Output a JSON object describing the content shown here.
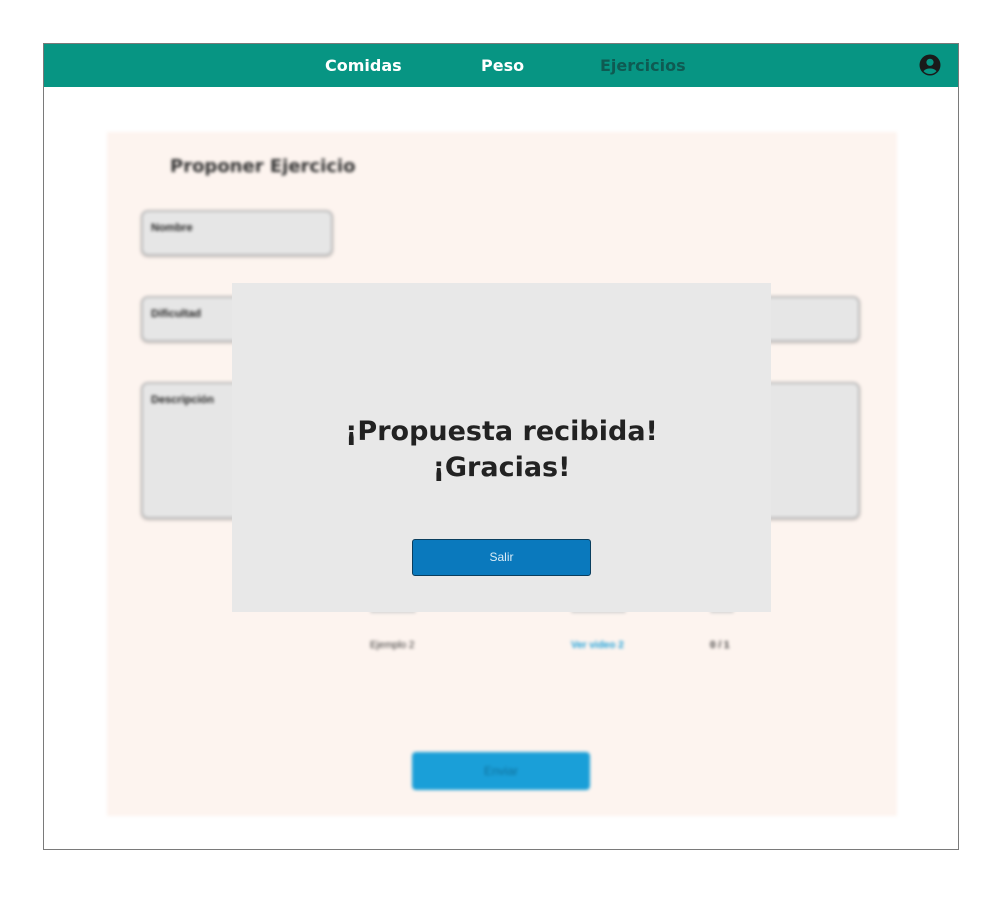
{
  "nav": {
    "items": [
      {
        "label": "Comidas"
      },
      {
        "label": "Peso"
      },
      {
        "label": "Ejercicios"
      }
    ],
    "profile_icon": "user-circle-icon"
  },
  "form": {
    "title": "Proponer Ejercicio",
    "fields": {
      "nombre_placeholder": "Nombre",
      "dificultad_placeholder": "Dificultad",
      "descripcion_placeholder": "Descripción"
    },
    "examples": [
      {
        "name": "Ejemplo 2",
        "link": "Ver video 2",
        "count": "0 / 1"
      }
    ],
    "submit_label": "Enviar"
  },
  "modal": {
    "line1": "¡Propuesta recibida!",
    "line2": "¡Gracias!",
    "exit_label": "Salir"
  },
  "colors": {
    "nav_bg": "#079583",
    "panel_bg": "#fdf4ef",
    "modal_bg": "#e8e8e8",
    "exit_button": "#0a79bd",
    "submit_button": "#1a9fd8"
  }
}
